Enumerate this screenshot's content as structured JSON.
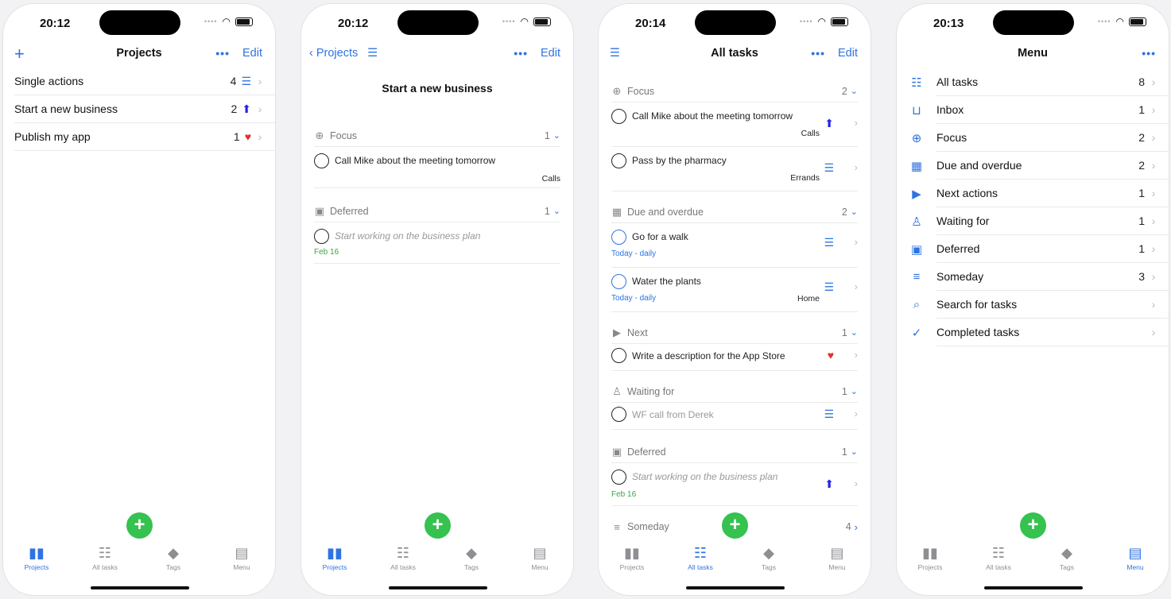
{
  "common": {
    "fab_label": "+",
    "chevron": "›",
    "section_chevron": "⌄",
    "ellipsis": "•••",
    "tabs": [
      {
        "label": "Projects",
        "icon": "book-icon"
      },
      {
        "label": "All tasks",
        "icon": "checklist-icon"
      },
      {
        "label": "Tags",
        "icon": "tag-icon"
      },
      {
        "label": "Menu",
        "icon": "menu-icon"
      }
    ]
  },
  "screen1": {
    "time": "20:12",
    "title": "Projects",
    "add": "+",
    "edit": "Edit",
    "rows": [
      {
        "label": "Single actions",
        "count": "4",
        "icon": "list-icon"
      },
      {
        "label": "Start a new business",
        "count": "2",
        "icon": "arrow-up-icon"
      },
      {
        "label": "Publish my app",
        "count": "1",
        "icon": "heart-icon"
      }
    ]
  },
  "screen2": {
    "time": "20:12",
    "back": "Projects",
    "edit": "Edit",
    "project_title": "Start a new business",
    "sections": [
      {
        "title": "Focus",
        "count": "1"
      },
      {
        "title": "Deferred",
        "count": "1"
      }
    ],
    "tasks": [
      {
        "title": "Call Mike about the meeting tomorrow",
        "context": "Calls"
      },
      {
        "title": "Start working on the business plan",
        "date": "Feb 16"
      }
    ]
  },
  "screen3": {
    "time": "20:14",
    "title": "All tasks",
    "edit": "Edit",
    "sections": [
      {
        "title": "Focus",
        "count": "2"
      },
      {
        "title": "Due and overdue",
        "count": "2"
      },
      {
        "title": "Next",
        "count": "1"
      },
      {
        "title": "Waiting for",
        "count": "1"
      },
      {
        "title": "Deferred",
        "count": "1"
      },
      {
        "title": "Someday",
        "count": "4"
      }
    ],
    "tasks": [
      {
        "title": "Call Mike about the meeting tomorrow",
        "context": "Calls"
      },
      {
        "title": "Pass by the pharmacy",
        "context": "Errands"
      },
      {
        "title": "Go for a walk",
        "repeat": "Today - daily"
      },
      {
        "title": "Water the plants",
        "repeat": "Today - daily",
        "context": "Home"
      },
      {
        "title": "Write a description for the App Store"
      },
      {
        "title": "WF call from Derek"
      },
      {
        "title": "Start working on the business plan",
        "date": "Feb 16"
      }
    ]
  },
  "screen4": {
    "time": "20:13",
    "title": "Menu",
    "items": [
      {
        "label": "All tasks",
        "count": "8",
        "icon": "checklist-icon"
      },
      {
        "label": "Inbox",
        "count": "1",
        "icon": "inbox-icon"
      },
      {
        "label": "Focus",
        "count": "2",
        "icon": "crosshair-icon"
      },
      {
        "label": "Due and overdue",
        "count": "2",
        "icon": "calendar-icon"
      },
      {
        "label": "Next actions",
        "count": "1",
        "icon": "terminal-icon"
      },
      {
        "label": "Waiting for",
        "count": "1",
        "icon": "person-clock-icon"
      },
      {
        "label": "Deferred",
        "count": "1",
        "icon": "calendar-clock-icon"
      },
      {
        "label": "Someday",
        "count": "3",
        "icon": "someday-icon"
      },
      {
        "label": "Search for tasks",
        "count": "",
        "icon": "search-icon"
      },
      {
        "label": "Completed tasks",
        "count": "",
        "icon": "checkmark-circle-icon"
      }
    ]
  }
}
